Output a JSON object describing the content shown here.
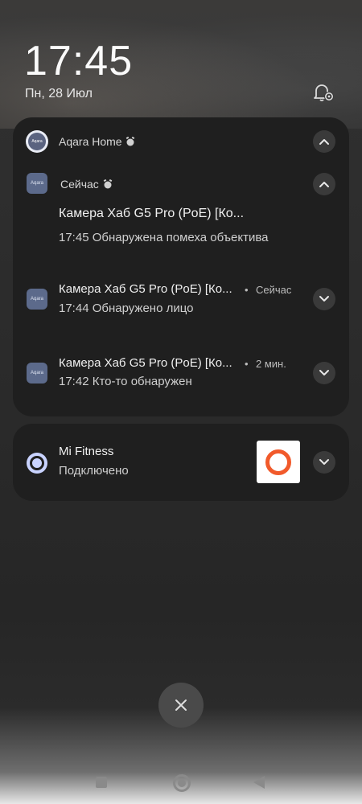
{
  "lockscreen": {
    "time": "17:45",
    "date": "Пн, 28 Июл"
  },
  "aqara_group": {
    "app_name": "Aqara Home",
    "icon_text": "Aqara",
    "notifications": [
      {
        "time_label": "Сейчас",
        "title": "Камера Хаб G5 Pro (PoE) [Ко...",
        "body": "17:45 Обнаружена помеха объектива"
      },
      {
        "title": "Камера Хаб G5 Pro (PoE) [Ко...",
        "time_label": "Сейчас",
        "body": "17:44 Обнаружено лицо"
      },
      {
        "title": "Камера Хаб G5 Pro (PoE) [Ко...",
        "time_label": "2 мин.",
        "body": "17:42 Кто-то обнаружен"
      }
    ]
  },
  "mi_fitness": {
    "app_name": "Mi Fitness",
    "status": "Подключено",
    "accent": "#f15a2b"
  },
  "separator": "•",
  "icons": {
    "notification_settings": "bell-gear-icon",
    "alarm": "alarm-icon",
    "collapse": "chevron-up-icon",
    "expand": "chevron-down-icon",
    "close": "close-icon",
    "recents": "square-icon",
    "home": "circle-icon",
    "back": "triangle-back-icon"
  }
}
